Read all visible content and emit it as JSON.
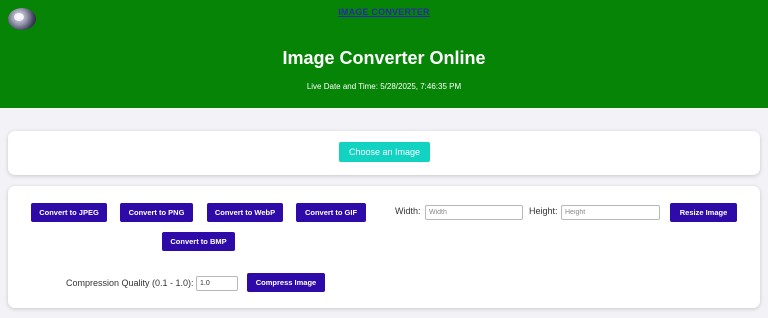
{
  "header": {
    "nav_link": "IMAGE CONVERTER",
    "title": "Image Converter Online",
    "datetime": "Live Date and Time: 5/28/2025, 7:46:35 PM",
    "background_color": "#058405"
  },
  "upload": {
    "choose_label": "Choose an Image",
    "button_color": "#12d2c2"
  },
  "convert": {
    "jpeg_label": "Convert to JPEG",
    "png_label": "Convert to PNG",
    "webp_label": "Convert to WebP",
    "gif_label": "Convert to GIF",
    "bmp_label": "Convert to BMP",
    "button_color": "#2e0aa8"
  },
  "resize": {
    "width_label": "Width:",
    "width_placeholder": "Width",
    "height_label": "Height:",
    "height_placeholder": "Height",
    "resize_label": "Resize Image"
  },
  "compress": {
    "quality_label": "Compression Quality (0.1 - 1.0):",
    "quality_value": "1.0",
    "compress_label": "Compress Image"
  }
}
